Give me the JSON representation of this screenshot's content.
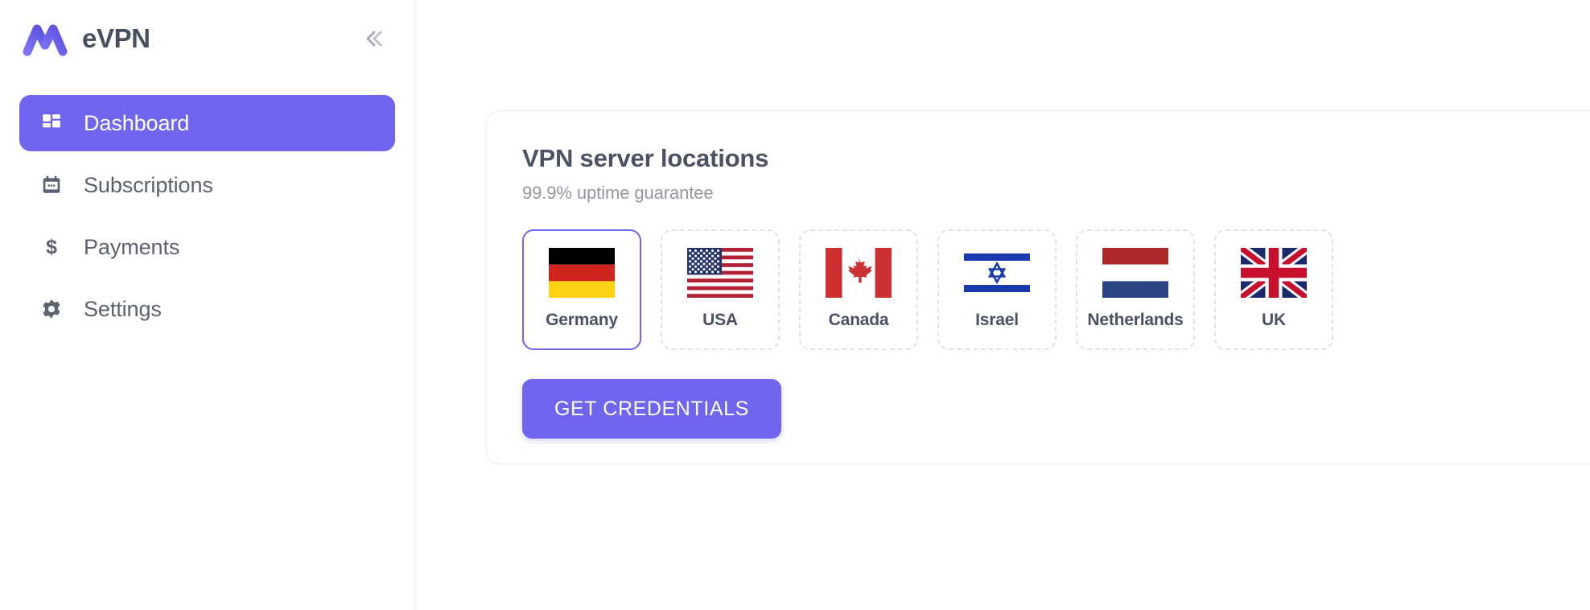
{
  "sidebar": {
    "brand": {
      "title": "eVPN",
      "logo_icon": "m-logo-icon",
      "logo_color": "#6c63f0"
    },
    "collapse_icon": "double-chevron-left-icon",
    "items": [
      {
        "label": "Dashboard",
        "icon": "dashboard-grid-icon",
        "active": true
      },
      {
        "label": "Subscriptions",
        "icon": "calendar-icon",
        "active": false
      },
      {
        "label": "Payments",
        "icon": "dollar-sign-icon",
        "active": false
      },
      {
        "label": "Settings",
        "icon": "gear-icon",
        "active": false
      }
    ]
  },
  "main": {
    "card": {
      "title": "VPN server locations",
      "subtitle": "99.9% uptime guarantee",
      "cta_label": "GET CREDENTIALS",
      "accent_color": "#7065ee",
      "locations": [
        {
          "label": "Germany",
          "flag": "flag-de",
          "selected": true
        },
        {
          "label": "USA",
          "flag": "flag-us",
          "selected": false
        },
        {
          "label": "Canada",
          "flag": "flag-ca",
          "selected": false
        },
        {
          "label": "Israel",
          "flag": "flag-il",
          "selected": false
        },
        {
          "label": "Netherlands",
          "flag": "flag-nl",
          "selected": false
        },
        {
          "label": "UK",
          "flag": "flag-gb",
          "selected": false
        }
      ]
    }
  }
}
